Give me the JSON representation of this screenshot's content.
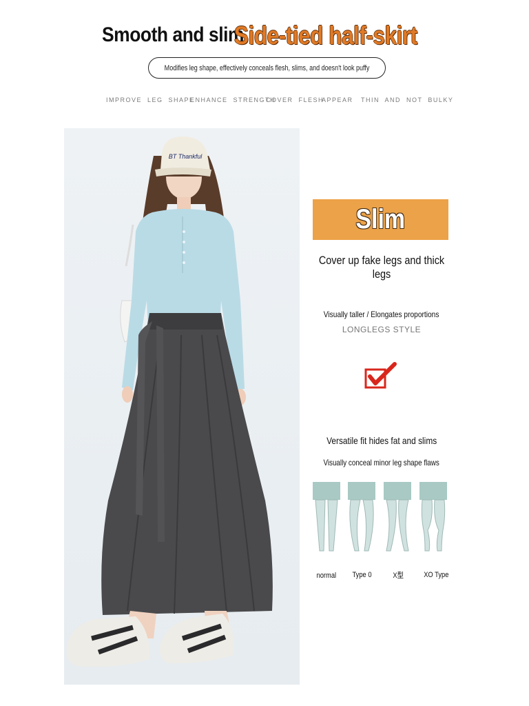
{
  "header": {
    "title_left": "Smooth and slim",
    "title_right": "Side-tied half-skirt",
    "subtitle": "Modifies leg shape, effectively conceals flesh, slims, and doesn't look puffy"
  },
  "features": [
    "IMPROVE LEG SHAPE",
    "ENHANCE STRENGTH",
    "COVER FLESH",
    "APPEAR",
    "THIN AND NOT BULKY"
  ],
  "photo": {
    "cap_text": "BT Thankful"
  },
  "panel": {
    "banner": "Slim",
    "cover": "Cover up fake legs and thick legs",
    "taller": "Visually taller / Elongates proportions",
    "longlegs": "LONGLEGS STYLE",
    "versatile": "Versatile fit hides fat and slims",
    "conceal": "Visually conceal minor leg shape flaws"
  },
  "leg_types": [
    {
      "label": "normal"
    },
    {
      "label": "Type 0"
    },
    {
      "label": "X型"
    },
    {
      "label": "XO Type"
    }
  ],
  "colors": {
    "accent_orange": "#e07a26",
    "banner_orange": "#eca248",
    "check_red": "#d9261c",
    "leg_teal": "#a8c9c4",
    "skirt_gray": "#4a4a4c",
    "top_blue": "#b9dbe6"
  }
}
